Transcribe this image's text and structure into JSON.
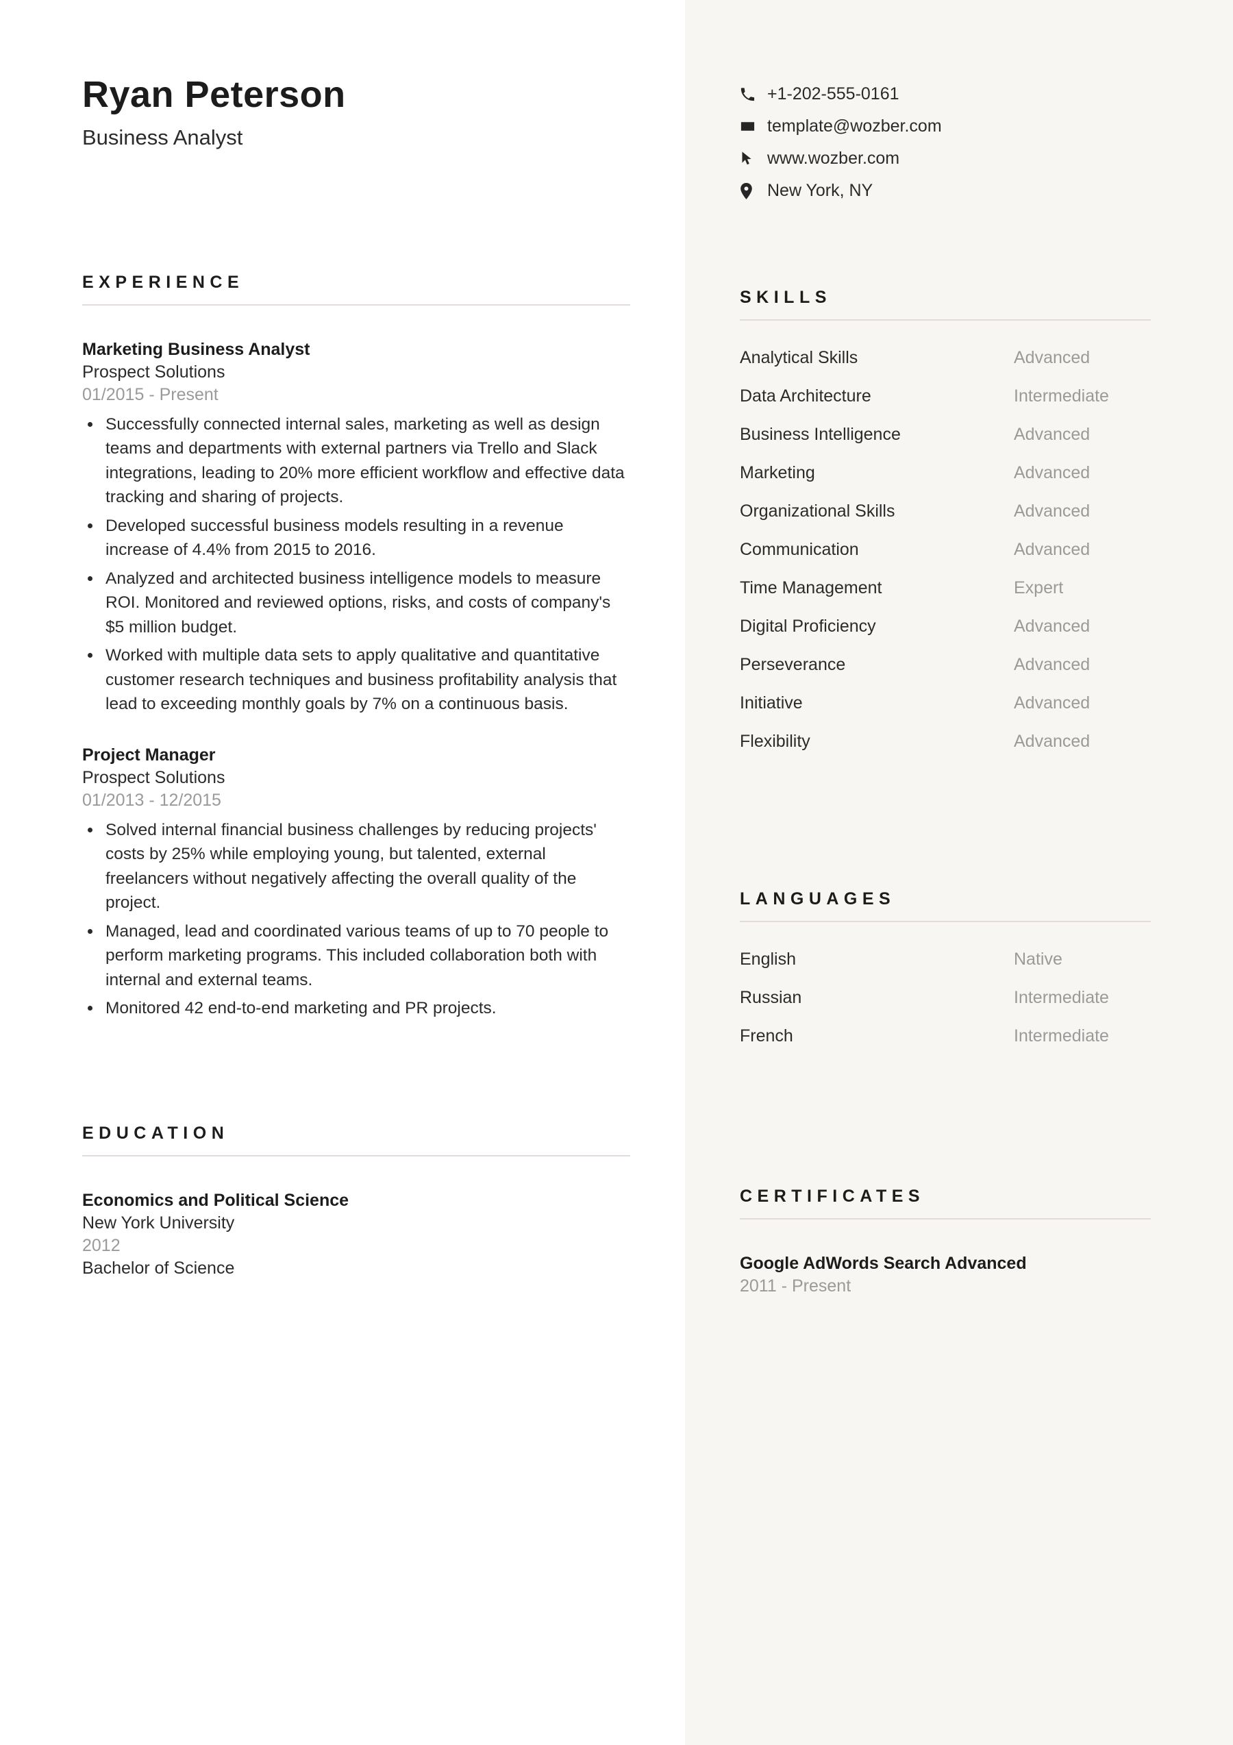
{
  "header": {
    "name": "Ryan Peterson",
    "job_title": "Business Analyst"
  },
  "contact": {
    "items": [
      {
        "icon": "phone-icon",
        "text": "+1-202-555-0161"
      },
      {
        "icon": "email-icon",
        "text": "template@wozber.com"
      },
      {
        "icon": "website-cursor-icon",
        "text": "www.wozber.com"
      },
      {
        "icon": "location-pin-icon",
        "text": "New York, NY"
      }
    ]
  },
  "experience": {
    "heading": "EXPERIENCE",
    "entries": [
      {
        "title": "Marketing Business Analyst",
        "organization": "Prospect Solutions",
        "date": "01/2015 - Present",
        "bullets": [
          "Successfully connected internal sales, marketing as well as design teams and departments with external partners via Trello and Slack integrations, leading to 20% more efficient workflow and effective data tracking and sharing of projects.",
          "Developed successful business models resulting in a revenue increase of 4.4% from 2015 to 2016.",
          "Analyzed and architected business intelligence models to measure ROI. Monitored and reviewed options, risks, and costs of company's $5 million budget.",
          "Worked with multiple data sets to apply qualitative and quantitative customer research techniques and business profitability analysis that lead to exceeding monthly goals by 7% on a continuous basis."
        ]
      },
      {
        "title": "Project Manager",
        "organization": "Prospect Solutions",
        "date": "01/2013 - 12/2015",
        "bullets": [
          "Solved internal financial business challenges by reducing projects' costs by 25% while employing young, but talented, external freelancers without negatively affecting the overall quality of the project.",
          "Managed, lead and coordinated various teams of up to 70 people to perform marketing programs. This included collaboration both with internal and external teams.",
          "Monitored 42 end-to-end marketing and PR projects."
        ]
      }
    ]
  },
  "education": {
    "heading": "EDUCATION",
    "entries": [
      {
        "field": "Economics and Political Science",
        "school": "New York University",
        "year": "2012",
        "degree": "Bachelor of Science"
      }
    ]
  },
  "skills": {
    "heading": "SKILLS",
    "items": [
      {
        "name": "Analytical Skills",
        "level": "Advanced"
      },
      {
        "name": "Data Architecture",
        "level": "Intermediate"
      },
      {
        "name": "Business Intelligence",
        "level": "Advanced"
      },
      {
        "name": "Marketing",
        "level": "Advanced"
      },
      {
        "name": "Organizational Skills",
        "level": "Advanced"
      },
      {
        "name": "Communication",
        "level": "Advanced"
      },
      {
        "name": "Time Management",
        "level": "Expert"
      },
      {
        "name": "Digital Proficiency",
        "level": "Advanced"
      },
      {
        "name": "Perseverance",
        "level": "Advanced"
      },
      {
        "name": "Initiative",
        "level": "Advanced"
      },
      {
        "name": "Flexibility",
        "level": "Advanced"
      }
    ]
  },
  "languages": {
    "heading": "LANGUAGES",
    "items": [
      {
        "name": "English",
        "level": "Native"
      },
      {
        "name": "Russian",
        "level": "Intermediate"
      },
      {
        "name": "French",
        "level": "Intermediate"
      }
    ]
  },
  "certificates": {
    "heading": "CERTIFICATES",
    "items": [
      {
        "title": "Google AdWords Search Advanced",
        "date": "2011 - Present"
      }
    ]
  },
  "colors": {
    "left_background": "#ffffff",
    "right_background": "#f7f6f2",
    "text_primary": "#2b2b2b",
    "text_heading": "#1c1c1c",
    "text_muted": "#9a9a9a",
    "rule": "#e2dadb"
  }
}
